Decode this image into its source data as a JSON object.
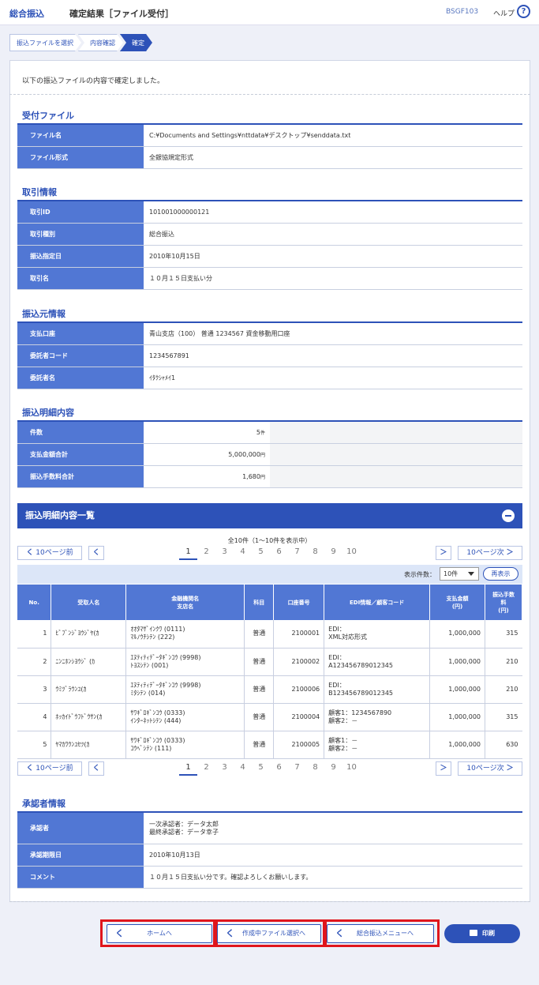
{
  "header": {
    "service": "総合振込",
    "title": "確定結果［ファイル受付］",
    "screen_id": "BSGF103",
    "help": "ヘルプ",
    "help_icon": "?"
  },
  "steps": [
    "振込ファイルを選択",
    "内容確認",
    "確定"
  ],
  "message": "以下の振込ファイルの内容で確定しました。",
  "received_file": {
    "heading": "受付ファイル",
    "rows": [
      {
        "k": "ファイル名",
        "v": "C:¥Documents and Settings¥nttdata¥デスクトップ¥senddata.txt"
      },
      {
        "k": "ファイル形式",
        "v": "全銀協規定形式"
      }
    ]
  },
  "transaction": {
    "heading": "取引情報",
    "rows": [
      {
        "k": "取引ID",
        "v": "101001000000121"
      },
      {
        "k": "取引種別",
        "v": "総合振込"
      },
      {
        "k": "振込指定日",
        "v": "2010年10月15日"
      },
      {
        "k": "取引名",
        "v": "１０月１５日支払い分"
      }
    ]
  },
  "source": {
    "heading": "振込元情報",
    "rows": [
      {
        "k": "支払口座",
        "v": "青山支店（100） 普通 1234567 資金移動用口座"
      },
      {
        "k": "委託者コード",
        "v": "1234567891"
      },
      {
        "k": "委託者名",
        "v": "ｲﾀｸｼｬﾒｲ1"
      }
    ]
  },
  "summary": {
    "heading": "振込明細内容",
    "rows": [
      {
        "k": "件数",
        "v": "5",
        "u": "件"
      },
      {
        "k": "支払金額合計",
        "v": "5,000,000",
        "u": "円"
      },
      {
        "k": "振込手数料合計",
        "v": "1,680",
        "u": "円"
      }
    ]
  },
  "list": {
    "heading": "振込明細内容一覧",
    "collapse_icon": "minus-icon",
    "total": "全10件（1～10件を表示中）",
    "prev10": "10ページ前",
    "next10": "10ページ次",
    "prev_glyph": "く",
    "next_glyph": "＞",
    "pages": [
      "1",
      "2",
      "3",
      "4",
      "5",
      "6",
      "7",
      "8",
      "9",
      "10"
    ],
    "display_count_label": "表示件数：",
    "display_count": "10件",
    "redisplay": "再表示",
    "columns": [
      "No.",
      "受取人名",
      "金融機関名\n支店名",
      "科目",
      "口座番号",
      "EDI情報／顧客コード",
      "支払金額\n(円)",
      "振込手数\n料\n(円)"
    ],
    "rows": [
      {
        "no": "1",
        "payee": "ﾋﾞﾌﾞﾝｼﾞﾖｳｼﾞﾔ(ｶ",
        "bank": "ｵｵﾀﾏｻﾞｲﾝｸﾜ (0111)\nﾏﾙﾉｳﾁｼﾃﾝ (222)",
        "type": "普通",
        "acct": "2100001",
        "edi": "EDI：\nXML対応形式",
        "amount": "1,000,000",
        "fee": "315"
      },
      {
        "no": "2",
        "payee": "ﾆﾝﾆﾎﾝｼﾖｳｼﾞ (ｶ",
        "bank": "ｴﾇﾃｨﾃｨﾃﾞｰﾀｷﾞﾝｺｳ (9998)\nﾄﾖｽｼﾃﾝ (001)",
        "type": "普通",
        "acct": "2100002",
        "edi": "EDI：\nA123456789012345",
        "amount": "1,000,000",
        "fee": "210"
      },
      {
        "no": "3",
        "payee": "ｳﾐﾂﾞﾗｳﾝﾕ(ｶ",
        "bank": "ｴﾇﾃｨﾃｨﾃﾞｰﾀｷﾞﾝｺｳ (9998)\nﾐﾀｼﾃﾝ (014)",
        "type": "普通",
        "acct": "2100006",
        "edi": "EDI：\nB123456789012345",
        "amount": "1,000,000",
        "fee": "210"
      },
      {
        "no": "4",
        "payee": "ﾎｯｶｲﾄﾞｳﾌﾄﾞｳｻﾝ(ｶ",
        "bank": "ｻﾜｷﾞﾛｷﾞﾝｺｳ (0333)\nｲﾝﾀｰﾈｯﾄｼﾃﾝ (444)",
        "type": "普通",
        "acct": "2100004",
        "edi": "顧客1：1234567890\n顧客2：－",
        "amount": "1,000,000",
        "fee": "315"
      },
      {
        "no": "5",
        "payee": "ﾔﾏｶﾜｳﾝﾕｾﾂ(ｶ",
        "bank": "ｻﾜｷﾞﾛｷﾞﾝｺｳ (0333)\nｺｳﾍﾞｼﾃﾝ (111)",
        "type": "普通",
        "acct": "2100005",
        "edi": "顧客1：－\n顧客2：－",
        "amount": "1,000,000",
        "fee": "630"
      }
    ]
  },
  "approver": {
    "heading": "承認者情報",
    "rows": [
      {
        "k": "承認者",
        "v": "一次承認者：データ太郎\n最終承認者：データ幸子"
      },
      {
        "k": "承認期限日",
        "v": "2010年10月13日"
      },
      {
        "k": "コメント",
        "v": "１０月１５日支払い分です。確認よろしくお願いします。"
      }
    ]
  },
  "buttons": {
    "home": "ホームへ",
    "file_select": "作成中ファイル選択へ",
    "menu": "総合振込メニューへ",
    "print": "印刷",
    "back_glyph": "く"
  },
  "colors": {
    "brand": "#2d52b8",
    "label_bg": "#5177d4",
    "highlight": "#e0151c"
  }
}
